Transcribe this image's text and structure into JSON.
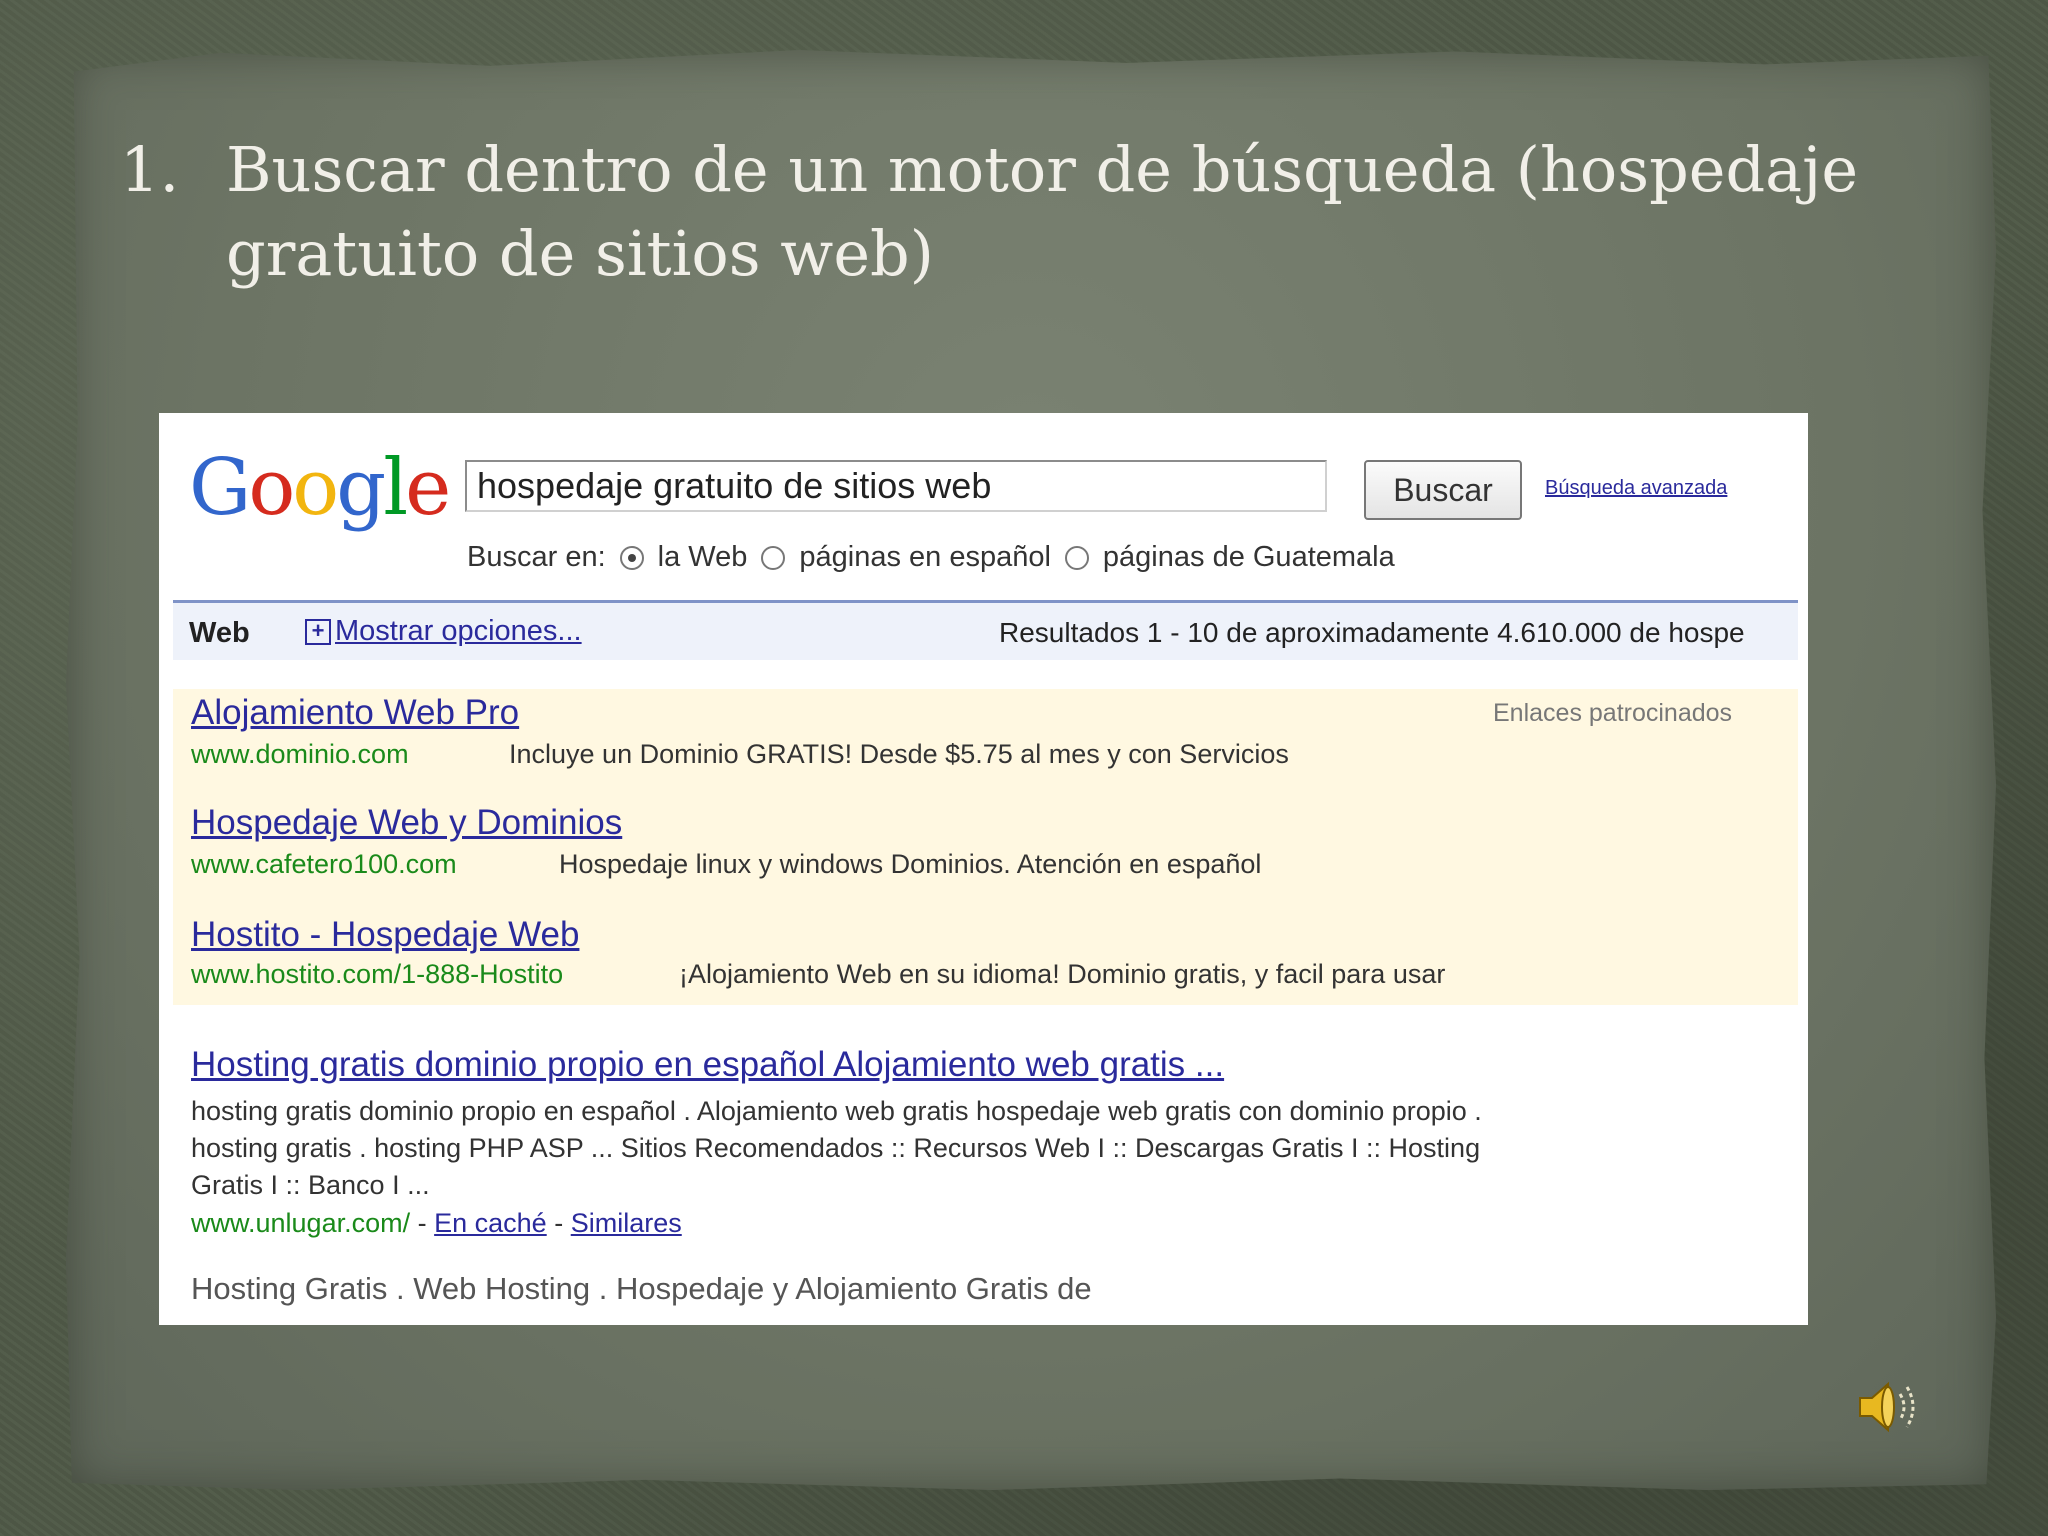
{
  "slide": {
    "number": "1.",
    "title": "Buscar dentro de un motor de búsqueda (hospedaje gratuito de sitios web)"
  },
  "google": {
    "logo_letters": [
      "G",
      "o",
      "o",
      "g",
      "l",
      "e"
    ],
    "query": "hospedaje gratuito de sitios web",
    "search_button": "Buscar",
    "advanced_link": "Búsqueda avanzada",
    "search_in_label": "Buscar en:",
    "options": [
      "la Web",
      "páginas en español",
      "páginas de Guatemala"
    ],
    "selected_option": "la Web"
  },
  "results_bar": {
    "tab": "Web",
    "show_options": "Mostrar opciones...",
    "stats": "Resultados 1 - 10 de aproximadamente 4.610.000 de hospe"
  },
  "sponsored": {
    "label": "Enlaces patrocinados",
    "ads": [
      {
        "title": "Alojamiento Web Pro",
        "url": "www.dominio.com",
        "desc": "Incluye un Dominio GRATIS! Desde $5.75 al mes y con Servicios"
      },
      {
        "title": "Hospedaje Web y Dominios",
        "url": "www.cafetero100.com",
        "desc": "Hospedaje linux y windows Dominios. Atención en español"
      },
      {
        "title": "Hostito - Hospedaje Web",
        "url": "www.hostito.com/1-888-Hostito",
        "desc": "¡Alojamiento Web en su idioma! Dominio gratis, y facil para usar"
      }
    ]
  },
  "organic": [
    {
      "title": "Hosting gratis dominio propio en español Alojamiento web gratis ...",
      "snippet": "hosting gratis dominio propio en español . Alojamiento web gratis hospedaje web gratis con dominio propio . hosting gratis . hosting PHP ASP ... Sitios Recomendados :: Recursos Web I :: Descargas Gratis I :: Hosting Gratis I :: Banco I ...",
      "url": "www.unlugar.com/",
      "cached": "En caché",
      "similar": "Similares"
    },
    {
      "title": "Hosting Gratis . Web Hosting . Hospedaje y Alojamiento Gratis de"
    }
  ],
  "icons": {
    "speaker": "speaker-icon"
  },
  "colors": {
    "link": "#2a2a9c",
    "url_green": "#1a8a1a",
    "ad_bg": "#fff8e1",
    "slide_bg": "#6c7464",
    "title_text": "#f1efe8"
  }
}
